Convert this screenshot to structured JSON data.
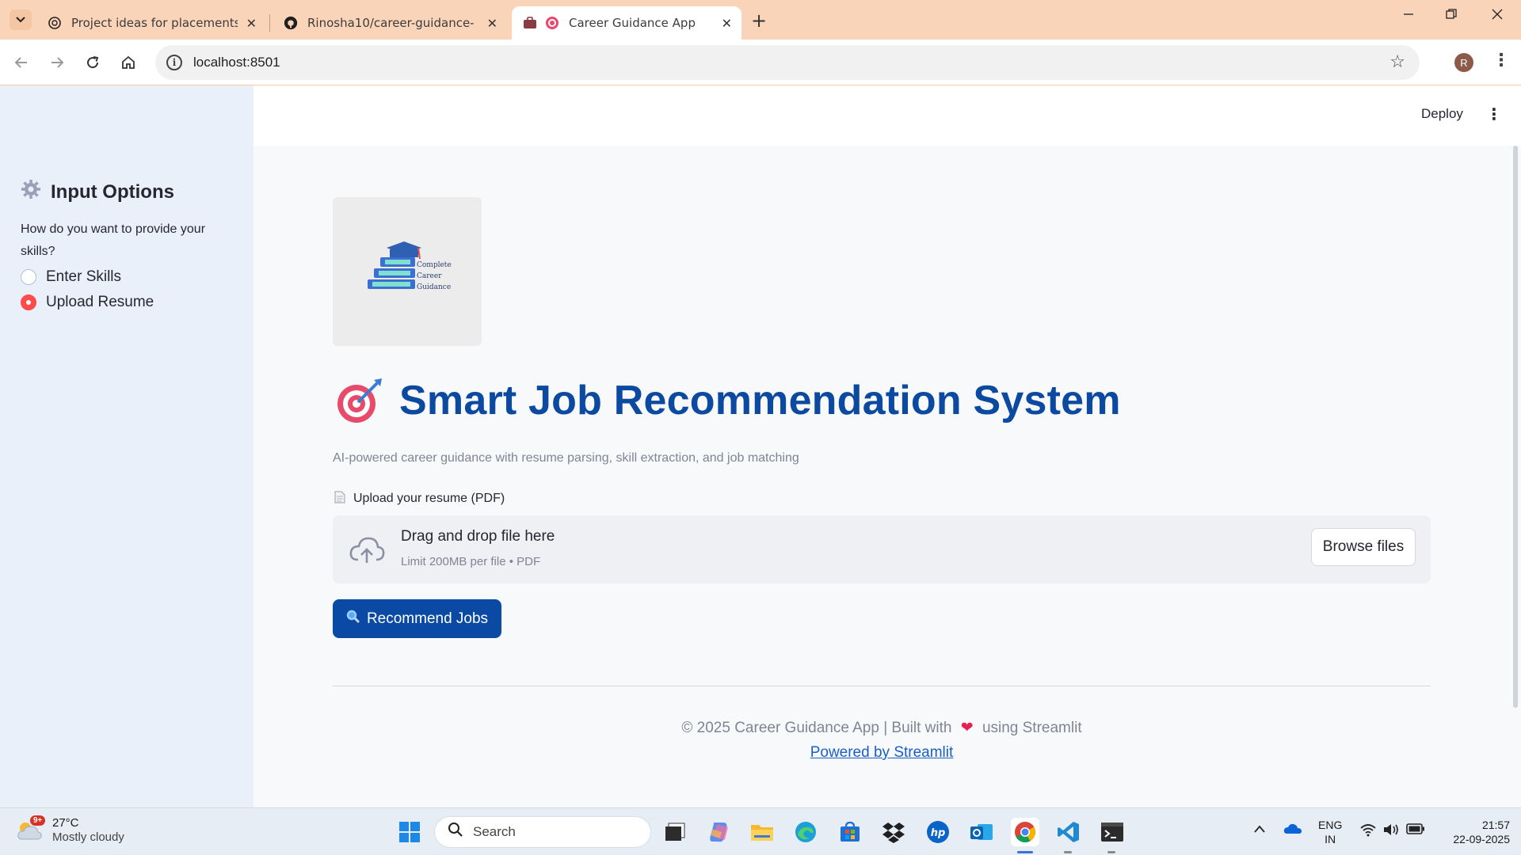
{
  "browser": {
    "tabs": [
      {
        "title": "Project ideas for placements",
        "icon": "chatgpt-icon"
      },
      {
        "title": "Rinosha10/career-guidance-app",
        "icon": "github-icon"
      },
      {
        "title": "Career Guidance App",
        "icon": "streamlit-target-icon",
        "active": true
      }
    ],
    "close_symbol": "✕",
    "new_tab_symbol": "+",
    "url": "localhost:8501",
    "profile_initial": "R"
  },
  "header": {
    "deploy_label": "Deploy"
  },
  "sidebar": {
    "title": "Input Options",
    "question": "How do you want to provide your skills?",
    "options": [
      {
        "label": "Enter Skills",
        "selected": false
      },
      {
        "label": "Upload Resume",
        "selected": true
      }
    ]
  },
  "main": {
    "logo_text": [
      "Complete",
      "Career",
      "Guidance"
    ],
    "title": "Smart Job Recommendation System",
    "subtitle": "AI-powered career guidance with resume parsing, skill extraction, and job matching",
    "upload_label": "Upload your resume (PDF)",
    "dropzone_title": "Drag and drop file here",
    "dropzone_hint": "Limit 200MB per file • PDF",
    "browse_label": "Browse files",
    "recommend_label": "Recommend Jobs",
    "footer_prefix": "© 2025 Career Guidance App | Built with",
    "footer_suffix": "using Streamlit",
    "footer_link": "Powered by Streamlit"
  },
  "taskbar": {
    "weather_badge": "9+",
    "temperature": "27°C",
    "condition": "Mostly cloudy",
    "search_placeholder": "Search",
    "language_line1": "ENG",
    "language_line2": "IN",
    "time": "21:57",
    "date": "22-09-2025"
  },
  "colors": {
    "accent_primary": "#0a4aa5",
    "title_blue": "#0b4aa0",
    "radio_selected": "#ff4b4b",
    "tabstrip": "#fad4b8",
    "sidebar_bg": "#e9f0fa"
  }
}
